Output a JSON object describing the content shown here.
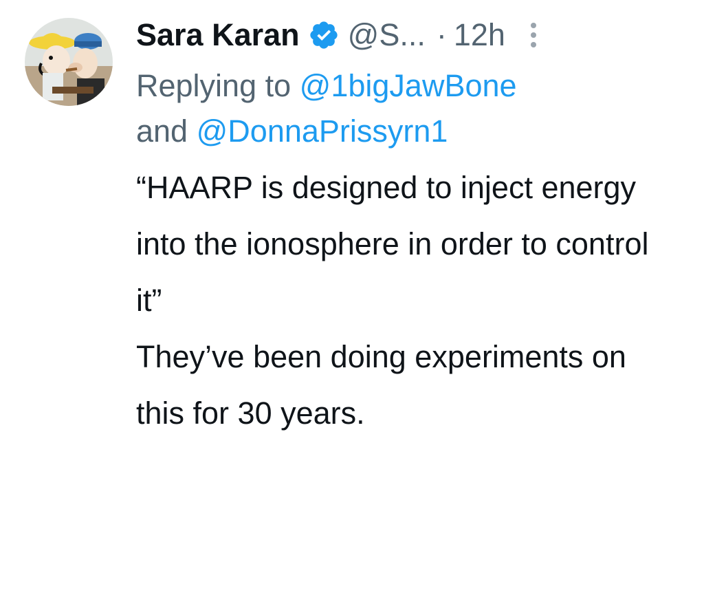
{
  "tweet": {
    "author": {
      "display_name": "Sara Karan",
      "handle": "@S...",
      "verified_icon": "verified-badge-icon",
      "avatar_icon": "cartoon-avatar-icon"
    },
    "separator": "·",
    "time": "12h",
    "more_icon": "more-vertical-icon",
    "reply_prefix": "Replying to",
    "reply_to": [
      "@1bigJawBone",
      "@DonnaPrissyrn1"
    ],
    "reply_join": "and",
    "body": [
      "“HAARP is designed to inject energy into the ionosphere in order to control it”",
      "They’ve been doing experiments on this for 30 years."
    ]
  },
  "colors": {
    "text": "#0f1419",
    "secondary": "#536471",
    "link": "#1d9bf0",
    "verified": "#1d9bf0"
  }
}
